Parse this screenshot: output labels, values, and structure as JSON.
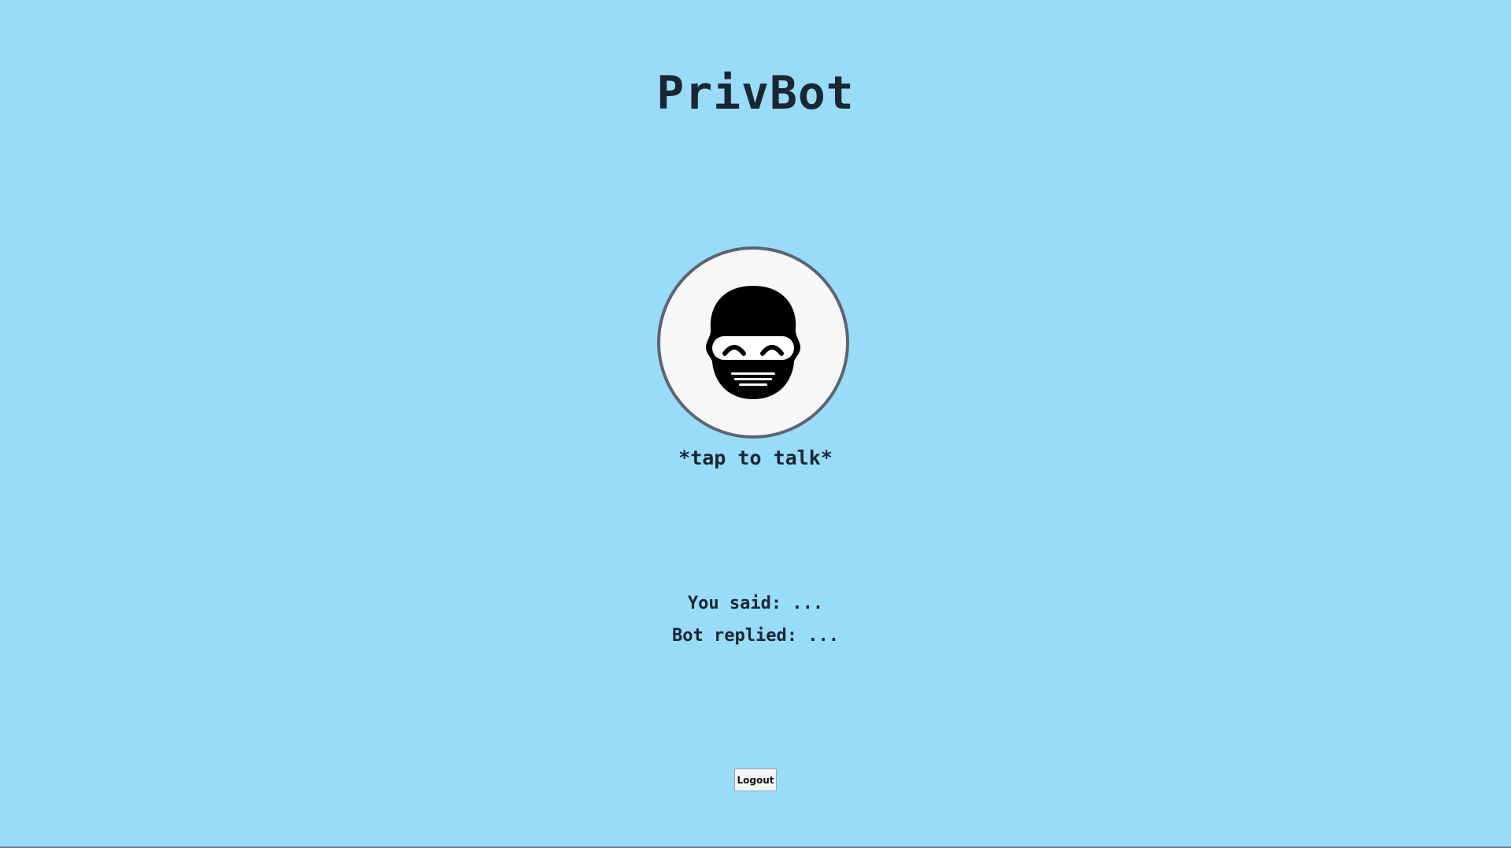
{
  "app": {
    "title": "PrivBot"
  },
  "talk_button": {
    "icon": "ninja-face-icon",
    "label": "*tap to talk*"
  },
  "transcript": {
    "you_said": "You said: ...",
    "bot_replied": "Bot replied: ..."
  },
  "logout_button": {
    "label": "Logout"
  },
  "colors": {
    "background": "#98dcfa",
    "avatar_fill": "#f7f7f7",
    "avatar_border": "#5d6470",
    "text": "#1b2630"
  }
}
